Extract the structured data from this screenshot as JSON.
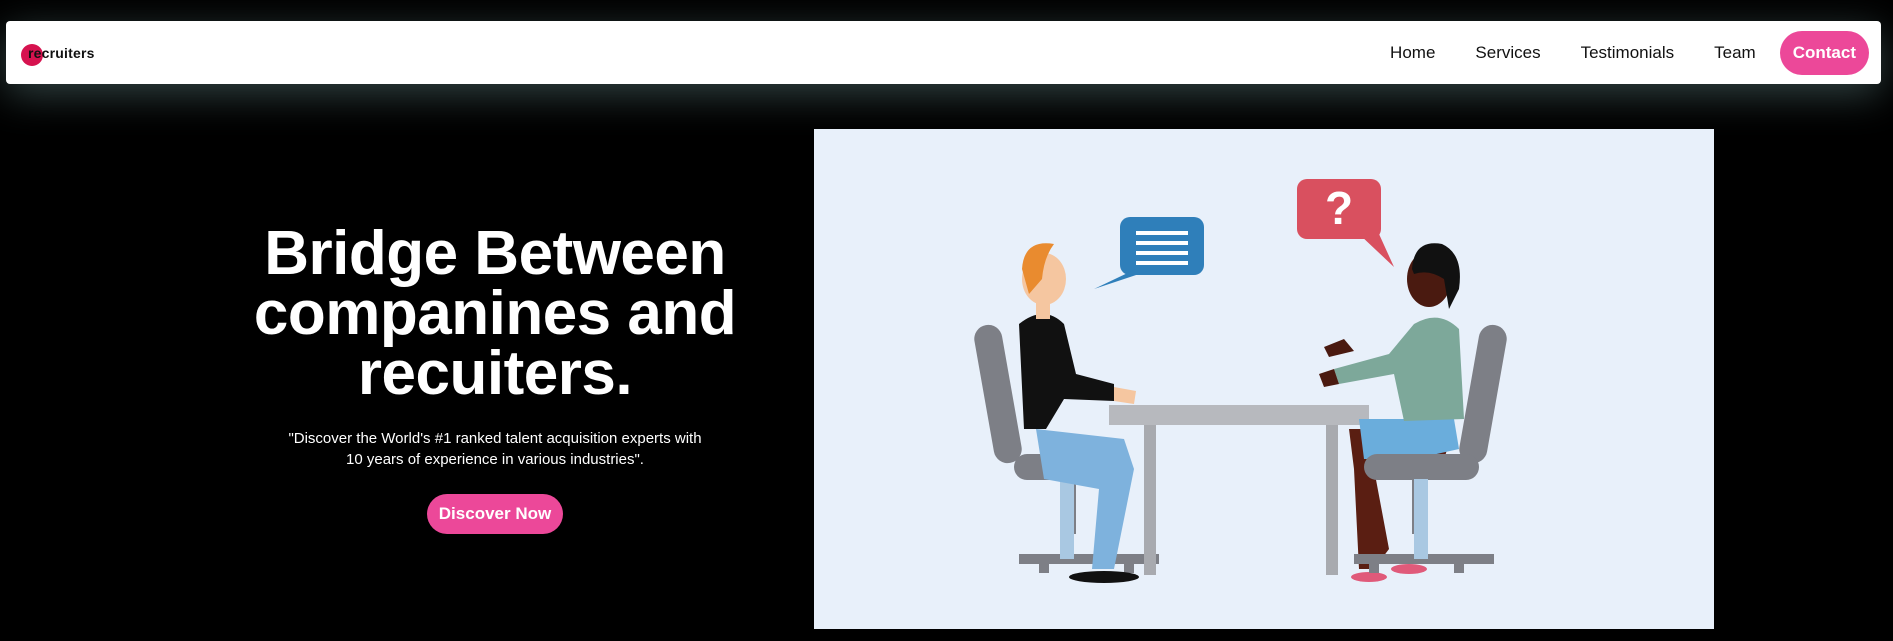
{
  "brand": {
    "logo_text": "recruiters",
    "accent_color": "#ec4899",
    "logo_color": "#d6124f"
  },
  "nav": {
    "items": [
      {
        "label": "Home"
      },
      {
        "label": "Services"
      },
      {
        "label": "Testimonials"
      },
      {
        "label": "Team"
      }
    ],
    "contact_label": "Contact"
  },
  "hero": {
    "title_line1": "Bridge Between",
    "title_line2": "companines and",
    "title_line3": "recuiters.",
    "description_line1": "\"Discover the World's #1 ranked talent acquisition experts with",
    "description_line2": "10 years of experience in various industries\".",
    "cta_label": "Discover Now"
  },
  "illustration": {
    "icon": "interview-illustration",
    "speech_bubble_symbol": "?"
  }
}
